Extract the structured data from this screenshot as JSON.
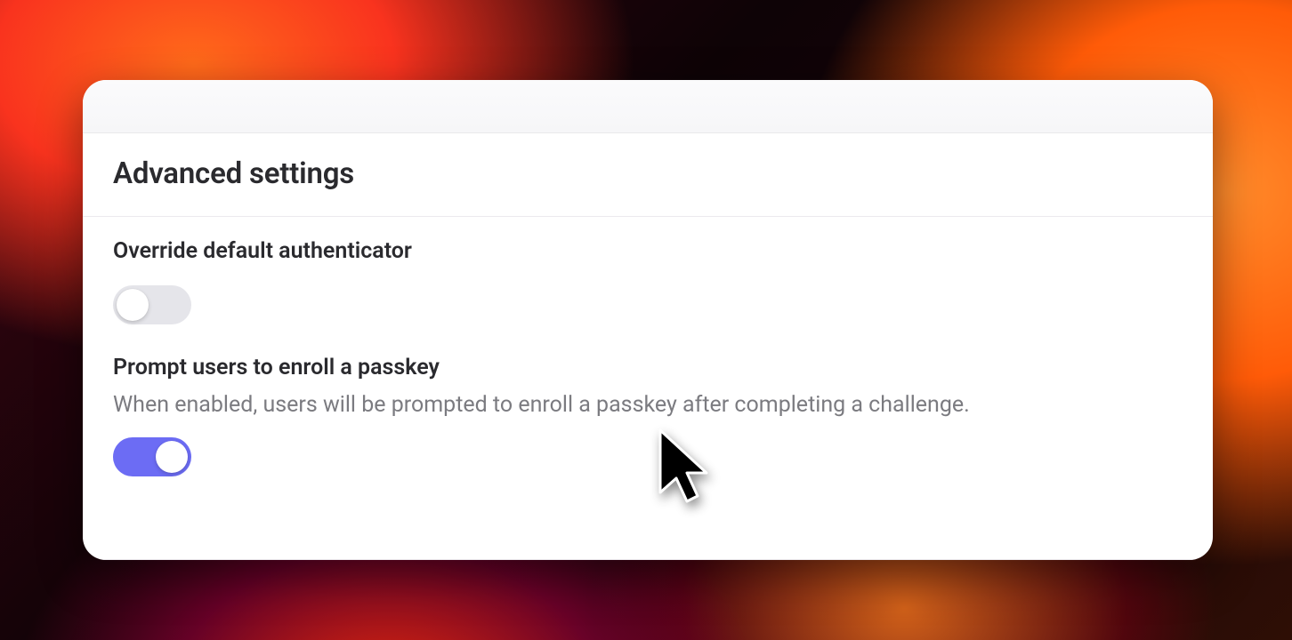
{
  "section": {
    "title": "Advanced settings"
  },
  "settings": {
    "override": {
      "label": "Override default authenticator",
      "enabled": false
    },
    "passkey": {
      "label": "Prompt users to enroll a passkey",
      "description": "When enabled, users will be prompted to enroll a passkey after completing a challenge.",
      "enabled": true
    }
  },
  "colors": {
    "accent": "#6c6cf4",
    "toggle_off": "#e5e5ea"
  }
}
